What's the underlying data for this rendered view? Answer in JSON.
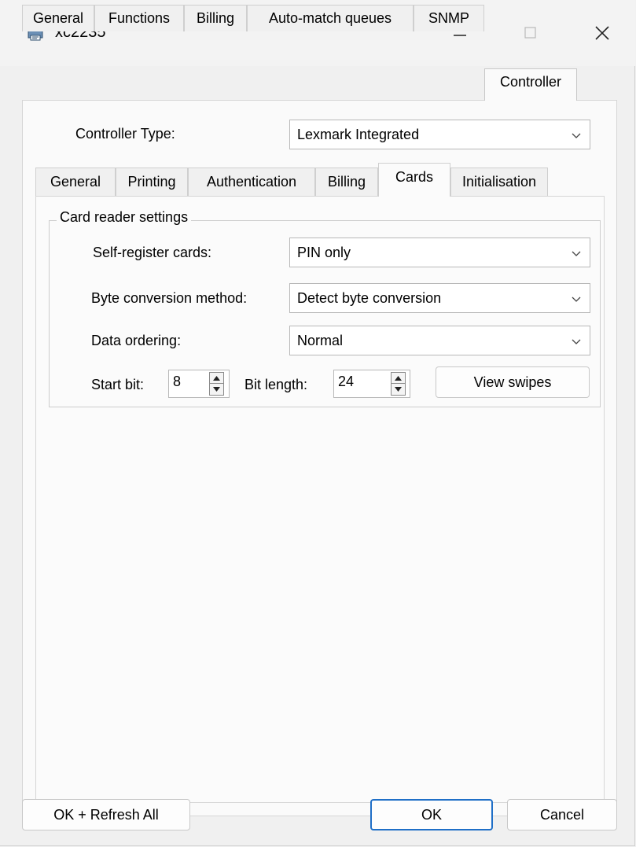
{
  "window": {
    "title": "xc2235",
    "icon": "printer-app-icon",
    "controls": {
      "minimize": "minimize-icon",
      "maximize": "maximize-icon",
      "close": "close-icon"
    }
  },
  "outer_tabs": [
    {
      "label": "General",
      "active": false
    },
    {
      "label": "Functions",
      "active": false
    },
    {
      "label": "Billing",
      "active": false
    },
    {
      "label": "Auto-match queues",
      "active": false
    },
    {
      "label": "SNMP",
      "active": false
    },
    {
      "label": "Controller",
      "active": true
    }
  ],
  "controller": {
    "type_label": "Controller Type:",
    "type_value": "Lexmark Integrated"
  },
  "inner_tabs": [
    {
      "label": "General",
      "active": false
    },
    {
      "label": "Printing",
      "active": false
    },
    {
      "label": "Authentication",
      "active": false
    },
    {
      "label": "Billing",
      "active": false
    },
    {
      "label": "Cards",
      "active": true
    },
    {
      "label": "Initialisation",
      "active": false
    }
  ],
  "card_reader": {
    "group_title": "Card reader settings",
    "self_register_label": "Self-register cards:",
    "self_register_value": "PIN only",
    "byte_conversion_label": "Byte conversion method:",
    "byte_conversion_value": "Detect byte conversion",
    "data_ordering_label": "Data ordering:",
    "data_ordering_value": "Normal",
    "start_bit_label": "Start bit:",
    "start_bit_value": "8",
    "bit_length_label": "Bit length:",
    "bit_length_value": "24",
    "view_swipes_label": "View swipes"
  },
  "footer": {
    "ok_refresh_label": "OK + Refresh All",
    "ok_label": "OK",
    "cancel_label": "Cancel"
  },
  "colors": {
    "default_button_border": "#1f6fc7"
  }
}
